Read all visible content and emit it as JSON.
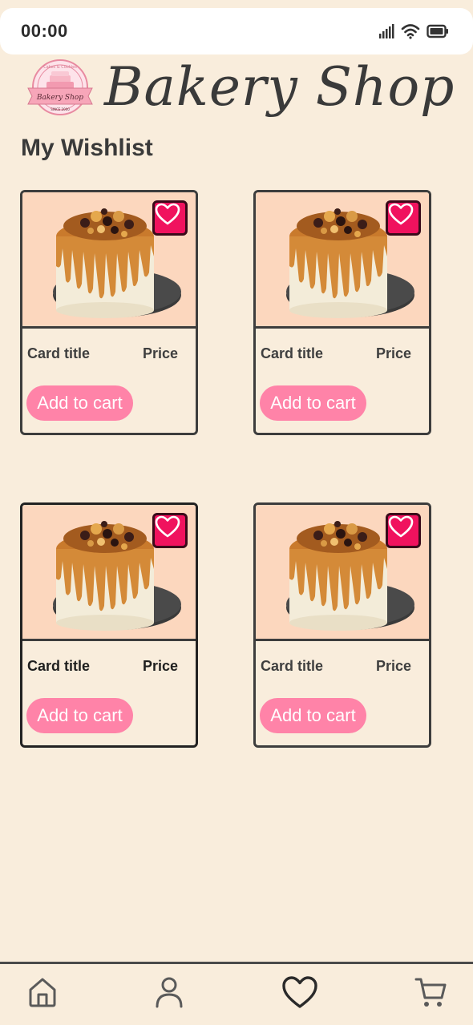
{
  "status_bar": {
    "time": "00:00"
  },
  "header": {
    "brand_title": "Bakery Shop",
    "logo_text": {
      "top": "Cakes & Cookies",
      "middle": "Bakery Shop",
      "bottom": "SINCE 2000"
    }
  },
  "page": {
    "title": "My Wishlist"
  },
  "cards": [
    {
      "title": "Card title",
      "price": "Price",
      "button": "Add to cart",
      "favorited": true
    },
    {
      "title": "Card title",
      "price": "Price",
      "button": "Add to cart",
      "favorited": true
    },
    {
      "title": "Card title",
      "price": "Price",
      "button": "Add to cart",
      "favorited": true
    },
    {
      "title": "Card title",
      "price": "Price",
      "button": "Add to cart",
      "favorited": true
    }
  ],
  "bottom_nav": {
    "items": [
      {
        "icon": "home-icon"
      },
      {
        "icon": "profile-icon"
      },
      {
        "icon": "heart-icon",
        "active": true
      },
      {
        "icon": "cart-icon"
      }
    ]
  },
  "colors": {
    "background": "#f9eddc",
    "accent_pink": "#ff83a8",
    "heart_red": "#f0125e",
    "image_bg": "#fcd7be"
  }
}
